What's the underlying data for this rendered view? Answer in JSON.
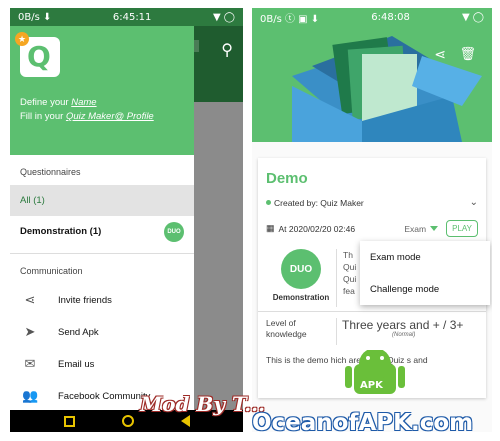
{
  "left": {
    "status": {
      "left": "0B/s ⬇",
      "time": "6:45:11",
      "right": "▼ ◯"
    },
    "header": {
      "line1_prefix": "Define your ",
      "line1_link": "Name",
      "line2_prefix": "Fill in your ",
      "line2_link": "Quiz Maker@ Profile"
    },
    "questionnaires_title": "Questionnaires",
    "items": [
      {
        "label": "All (1)"
      },
      {
        "label": "Demonstration (1)",
        "badge": "DUO"
      }
    ],
    "communication_title": "Communication",
    "nav": [
      {
        "icon": "share-icon",
        "label": "Invite friends"
      },
      {
        "icon": "send-icon",
        "label": "Send Apk"
      },
      {
        "icon": "email-icon",
        "label": "Email us"
      },
      {
        "icon": "people-icon",
        "label": "Facebook Community"
      }
    ]
  },
  "right": {
    "status": {
      "left": "0B/s ⓣ ▣ ⬇",
      "time": "6:48:08",
      "right": "▼ ◯"
    },
    "card": {
      "title": "Demo",
      "created": "Created by: Quiz Maker",
      "date": "At 2020/02/20 02:46",
      "mode": "Exam",
      "play": "PLAY",
      "logo_text": "DUO",
      "logo_label": "Demonstration",
      "desc_snip": "Th\nQui\nQui\nfea",
      "level_label": "Level of knowledge",
      "level_value": "Three years and + / 3+",
      "level_note": "(Normal)",
      "description": "This is the demo         hich are about Quiz       s and"
    },
    "menu": [
      "Exam mode",
      "Challenge mode"
    ]
  },
  "watermark": {
    "mod": "Mod By T...",
    "site": "OceanofAPK.com",
    "apk": "APK"
  },
  "colors": {
    "primary": "#5cbf70",
    "dark": "#1f5c2f",
    "nav": "#e8c400"
  }
}
